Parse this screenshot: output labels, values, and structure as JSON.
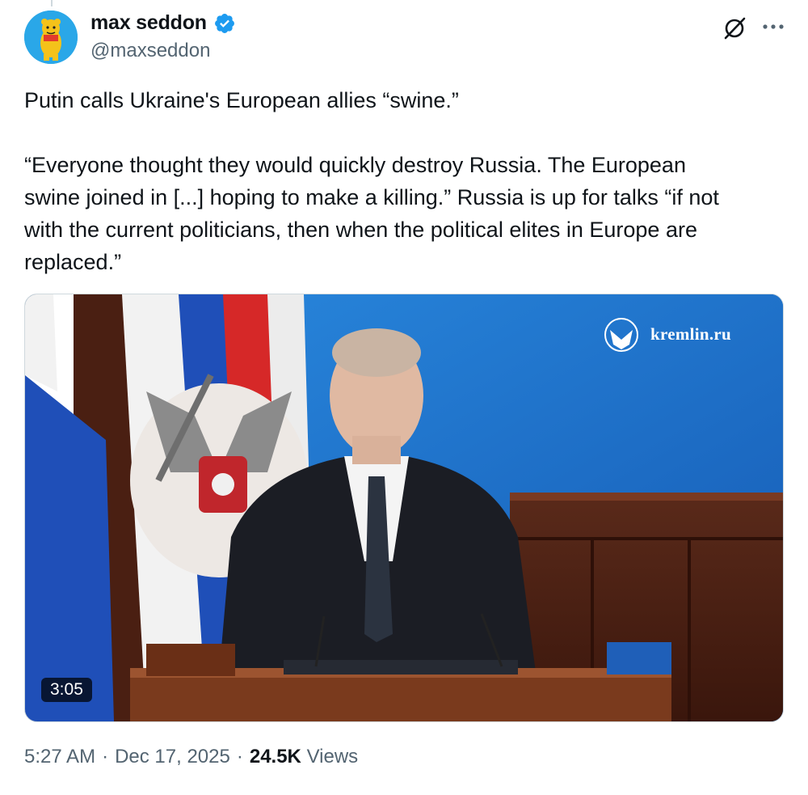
{
  "author": {
    "display_name": "max seddon",
    "handle": "@maxseddon",
    "verified": true,
    "avatar_icon": "cartoon-bear-avatar",
    "verified_icon": "verified-badge-icon"
  },
  "tweet": {
    "text": "Putin calls Ukraine's European allies “swine.”\n\n“Everyone thought they would quickly destroy Russia. The European\nswine joined in [...] hoping to make a killing.” Russia is up for talks “if not\nwith the current politicians, then when the political elites in Europe are\nreplaced.”"
  },
  "media": {
    "type": "video",
    "duration": "3:05",
    "watermark": "kremlin.ru"
  },
  "meta": {
    "time": "5:27 AM",
    "separator1": "·",
    "date": "Dec 17, 2025",
    "separator2": "·",
    "views_count": "24.5K",
    "views_label": "Views"
  },
  "icons": {
    "grok": "grok-icon",
    "more": "more-options-icon"
  },
  "colors": {
    "verified_blue": "#1d9bf0",
    "text_primary": "#0f1419",
    "text_secondary": "#536471"
  }
}
